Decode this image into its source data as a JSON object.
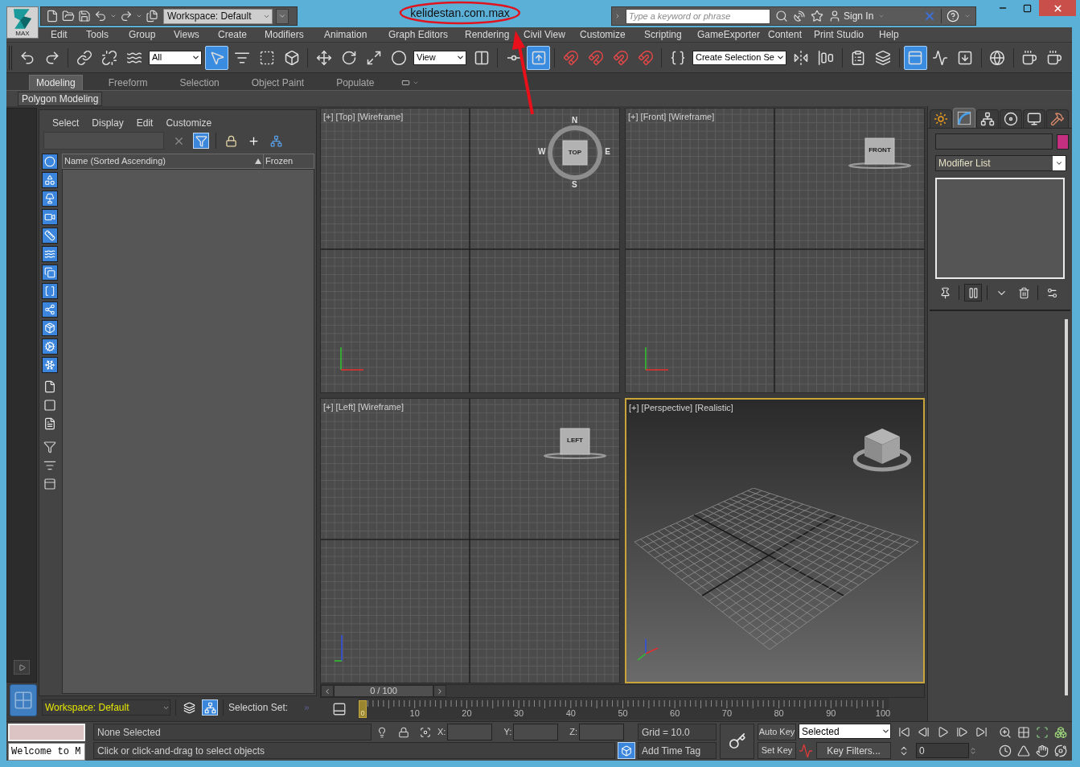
{
  "title_bar": {
    "app_button": {
      "label": "MAX"
    },
    "workspace": "Workspace: Default",
    "title": "kelidestan.com.max",
    "search": {
      "placeholder": "Type a keyword or phrase"
    },
    "sign_in": "Sign In"
  },
  "menu_bar": [
    "Edit",
    "Tools",
    "Group",
    "Views",
    "Create",
    "Modifiers",
    "Animation",
    "Graph Editors",
    "Rendering",
    "Civil View",
    "Customize",
    "Scripting",
    "GameExporter",
    "Content",
    "Print Studio",
    "Help"
  ],
  "main_toolbar": [
    {
      "kind": "button",
      "active": false
    },
    {
      "kind": "button",
      "active": false
    },
    {
      "kind": "separator"
    },
    {
      "kind": "button",
      "active": false
    },
    {
      "kind": "button",
      "active": false
    },
    {
      "kind": "button",
      "active": false
    },
    {
      "kind": "dropdown",
      "value": "All"
    },
    {
      "kind": "button",
      "active": true
    },
    {
      "kind": "button",
      "active": false
    },
    {
      "kind": "button",
      "active": false
    },
    {
      "kind": "button",
      "active": false
    },
    {
      "kind": "separator"
    },
    {
      "kind": "button",
      "active": false
    },
    {
      "kind": "button",
      "active": false
    },
    {
      "kind": "button",
      "active": false
    },
    {
      "kind": "button",
      "active": false
    },
    {
      "kind": "dropdown",
      "value": "View"
    },
    {
      "kind": "button",
      "active": false
    },
    {
      "kind": "separator"
    },
    {
      "kind": "button",
      "active": false
    },
    {
      "kind": "button",
      "active": true
    },
    {
      "kind": "separator"
    },
    {
      "kind": "button",
      "active": false
    },
    {
      "kind": "button",
      "active": false
    },
    {
      "kind": "button",
      "active": false
    },
    {
      "kind": "button",
      "active": false
    },
    {
      "kind": "separator"
    },
    {
      "kind": "button",
      "active": false
    },
    {
      "kind": "dropdown",
      "value": "Create Selection Se"
    },
    {
      "kind": "button",
      "active": false
    },
    {
      "kind": "button",
      "active": false
    },
    {
      "kind": "separator"
    },
    {
      "kind": "button",
      "active": false
    },
    {
      "kind": "button",
      "active": false
    },
    {
      "kind": "separator"
    },
    {
      "kind": "button",
      "active": true
    },
    {
      "kind": "button",
      "active": false
    },
    {
      "kind": "button",
      "active": false
    },
    {
      "kind": "separator"
    },
    {
      "kind": "button",
      "active": false
    },
    {
      "kind": "separator"
    },
    {
      "kind": "button",
      "active": false
    },
    {
      "kind": "button",
      "active": false
    }
  ],
  "ribbon": {
    "tabs": [
      {
        "label": "Modeling",
        "selected": true
      },
      {
        "label": "Freeform",
        "selected": false
      },
      {
        "label": "Selection",
        "selected": false
      },
      {
        "label": "Object Paint",
        "selected": false
      },
      {
        "label": "Populate",
        "selected": false
      }
    ],
    "panel": "Polygon Modeling"
  },
  "scene_explorer": {
    "menu": [
      "Select",
      "Display",
      "Edit",
      "Customize"
    ],
    "search_tools": [
      {
        "on": false
      },
      {
        "on": true
      },
      {
        "on": false
      },
      {
        "on": false
      },
      {
        "on": false
      }
    ],
    "display_filters": [
      {
        "active": true
      },
      {
        "active": true
      },
      {
        "active": true
      },
      {
        "active": true
      },
      {
        "active": true
      },
      {
        "active": true
      },
      {
        "active": true
      },
      {
        "active": true
      },
      {
        "active": true
      },
      {
        "active": true
      },
      {
        "active": true
      },
      {
        "active": true
      }
    ],
    "columns": [
      "Name (Sorted Ascending)",
      "Frozen"
    ],
    "footer": {
      "workspace": "Workspace: Default",
      "buttons": [
        {
          "on": false
        },
        {
          "on": true
        }
      ],
      "selection_set_label": "Selection Set:"
    }
  },
  "viewports": [
    {
      "label": "[+] [Top] [Wireframe]",
      "kind": "wireframe",
      "active": false,
      "view_cube": {
        "face": "TOP",
        "compass": [
          "N",
          "E",
          "S",
          "W"
        ]
      }
    },
    {
      "label": "[+] [Front] [Wireframe]",
      "kind": "wireframe",
      "active": false,
      "view_cube": {
        "face": "FRONT"
      }
    },
    {
      "label": "[+] [Left] [Wireframe]",
      "kind": "wireframe",
      "active": false,
      "view_cube": {
        "face": "LEFT"
      }
    },
    {
      "label": "[+] [Perspective] [Realistic]",
      "kind": "perspective",
      "active": true
    }
  ],
  "time_slider": {
    "reading": "0 / 100",
    "level": 0
  },
  "timeline": {
    "current": "0",
    "labels": [
      "10",
      "20",
      "30",
      "40",
      "50",
      "60",
      "70",
      "80",
      "90",
      "100"
    ]
  },
  "command_panel": {
    "tabs": [
      {
        "selected": false
      },
      {
        "selected": true
      },
      {
        "selected": false
      },
      {
        "selected": false
      },
      {
        "selected": false
      },
      {
        "selected": false
      }
    ],
    "modifier_list": "Modifier List",
    "stack_buttons": [
      {
        "on": false
      },
      {
        "on": true
      },
      {
        "on": false
      },
      {
        "on": false
      },
      {
        "on": false
      }
    ]
  },
  "status_bar": {
    "listener_output": "Welcome to M",
    "selection": "None Selected",
    "prompt": "Click or click-and-drag to select objects",
    "coordinates": [
      "X:",
      "Y:",
      "Z:"
    ],
    "grid": "Grid = 10.0",
    "time_tag": "Add Time Tag",
    "toggle": {
      "on": true
    },
    "auto_key": "Auto Key",
    "set_key": "Set Key",
    "key_set": "Selected",
    "key_filters": "Key Filters...",
    "frame": "0"
  }
}
